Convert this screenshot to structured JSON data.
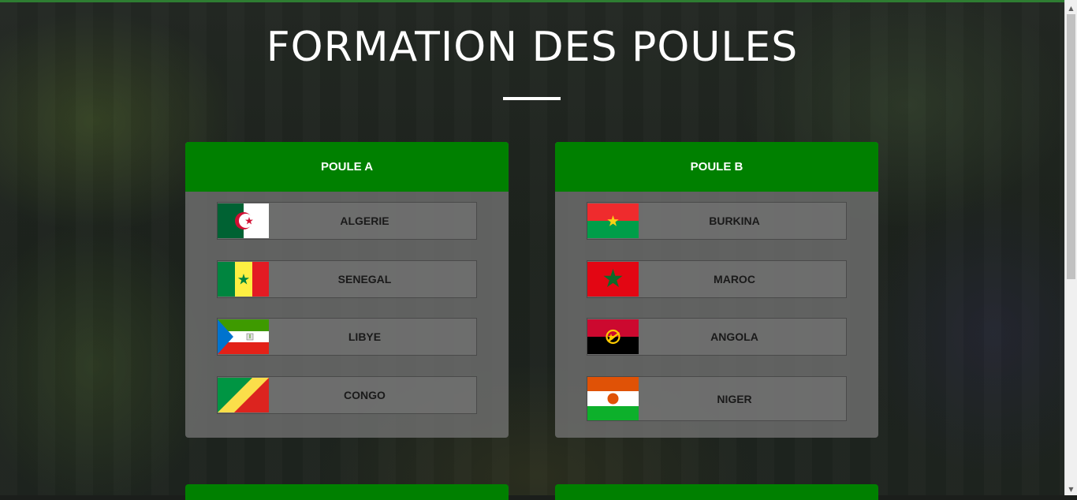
{
  "page": {
    "title": "FORMATION DES POULES"
  },
  "colors": {
    "header_green": "#008000",
    "card_gray": "#737373",
    "title_white": "#ffffff"
  },
  "groups": [
    {
      "label": "POULE A",
      "teams": [
        {
          "name": "ALGERIE",
          "flag_icon": "algeria-flag-icon"
        },
        {
          "name": "SENEGAL",
          "flag_icon": "senegal-flag-icon"
        },
        {
          "name": "LIBYE",
          "flag_icon": "equatorial-guinea-flag-icon"
        },
        {
          "name": "CONGO",
          "flag_icon": "congo-flag-icon"
        }
      ]
    },
    {
      "label": "POULE B",
      "teams": [
        {
          "name": "BURKINA",
          "flag_icon": "burkina-faso-flag-icon"
        },
        {
          "name": "MAROC",
          "flag_icon": "morocco-flag-icon"
        },
        {
          "name": "ANGOLA",
          "flag_icon": "angola-flag-icon"
        },
        {
          "name": "NIGER",
          "flag_icon": "niger-flag-icon"
        }
      ]
    }
  ]
}
